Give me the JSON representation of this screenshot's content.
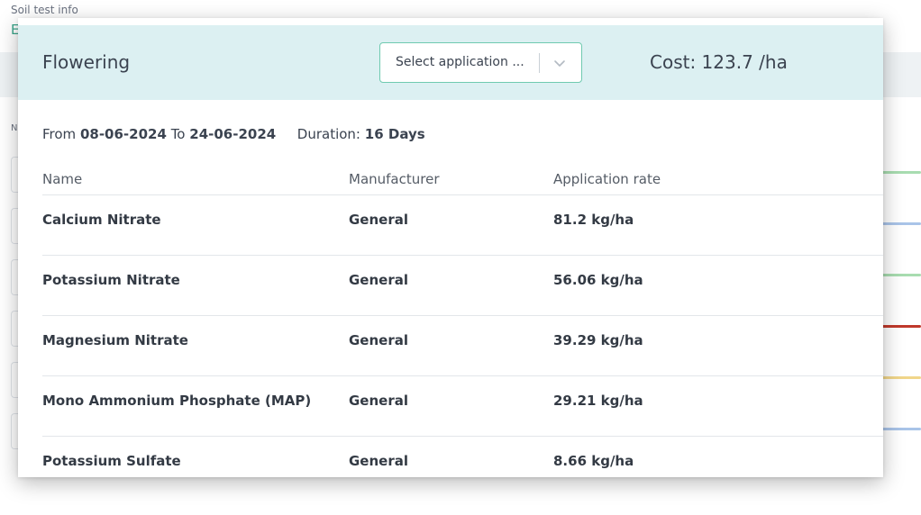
{
  "background": {
    "section_title": "Soil test info",
    "partial_letter": "E",
    "partial_label": "N"
  },
  "modal": {
    "stage": "Flowering",
    "select": {
      "placeholder": "Select application ..."
    },
    "cost": "Cost: 123.7 /ha",
    "period": {
      "from_label": "From",
      "from_date": "08-06-2024",
      "to_label": "To",
      "to_date": "24-06-2024",
      "duration_label": "Duration:",
      "duration_value": "16 Days"
    },
    "table": {
      "headers": [
        "Name",
        "Manufacturer",
        "Application rate"
      ],
      "rows": [
        {
          "name": "Calcium Nitrate",
          "manufacturer": "General",
          "rate": "81.2 kg/ha"
        },
        {
          "name": "Potassium Nitrate",
          "manufacturer": "General",
          "rate": "56.06 kg/ha"
        },
        {
          "name": "Magnesium Nitrate",
          "manufacturer": "General",
          "rate": "39.29 kg/ha"
        },
        {
          "name": "Mono Ammonium Phosphate (MAP)",
          "manufacturer": "General",
          "rate": "29.21 kg/ha"
        },
        {
          "name": "Potassium Sulfate",
          "manufacturer": "General",
          "rate": "8.66 kg/ha"
        }
      ]
    }
  },
  "colors": {
    "header_bg": "#dcf0f2",
    "select_border": "#6fcab0",
    "accent_green": "#3aa58a",
    "line_green": "#a8dcb0",
    "line_blue": "#a9c4e8",
    "line_red": "#c0392b",
    "line_yellow": "#f1d68a"
  }
}
